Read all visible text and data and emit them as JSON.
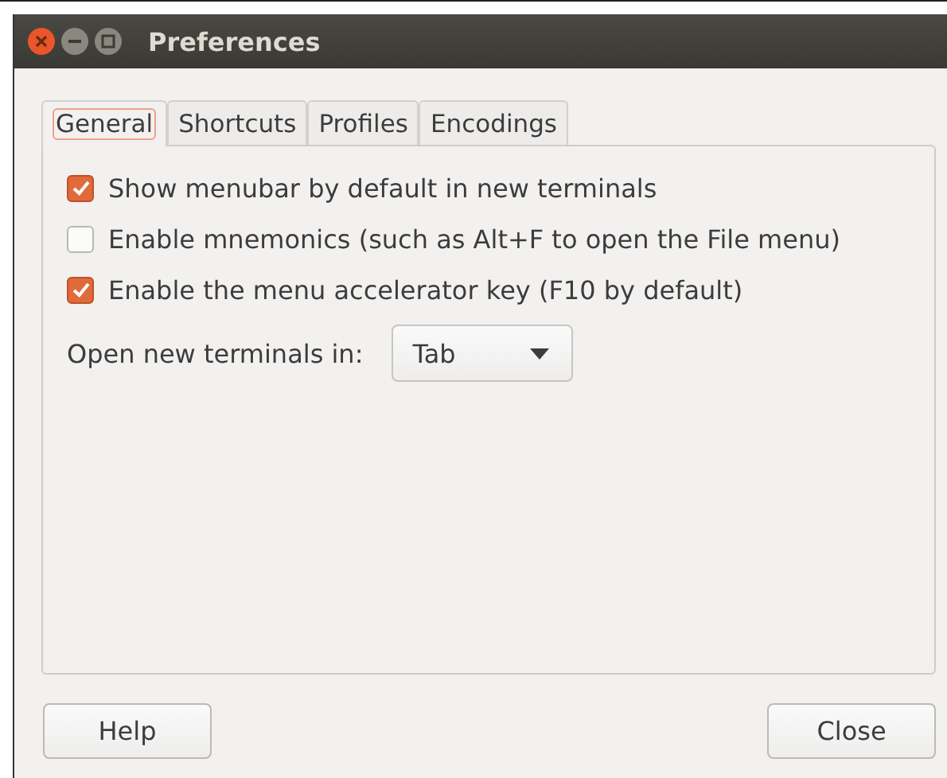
{
  "window": {
    "title": "Preferences"
  },
  "tabs": [
    {
      "label": "General",
      "selected": true
    },
    {
      "label": "Shortcuts",
      "selected": false
    },
    {
      "label": "Profiles",
      "selected": false
    },
    {
      "label": "Encodings",
      "selected": false
    }
  ],
  "options": [
    {
      "label": "Show menubar by default in new terminals",
      "checked": true
    },
    {
      "label": "Enable mnemonics (such as Alt+F to open the File menu)",
      "checked": false
    },
    {
      "label": "Enable the menu accelerator key (F10 by default)",
      "checked": true
    }
  ],
  "open_in": {
    "label": "Open new terminals in:",
    "value": "Tab"
  },
  "buttons": [
    {
      "label": "Help",
      "kind": "help"
    },
    {
      "label": "Close",
      "kind": "close"
    }
  ]
}
